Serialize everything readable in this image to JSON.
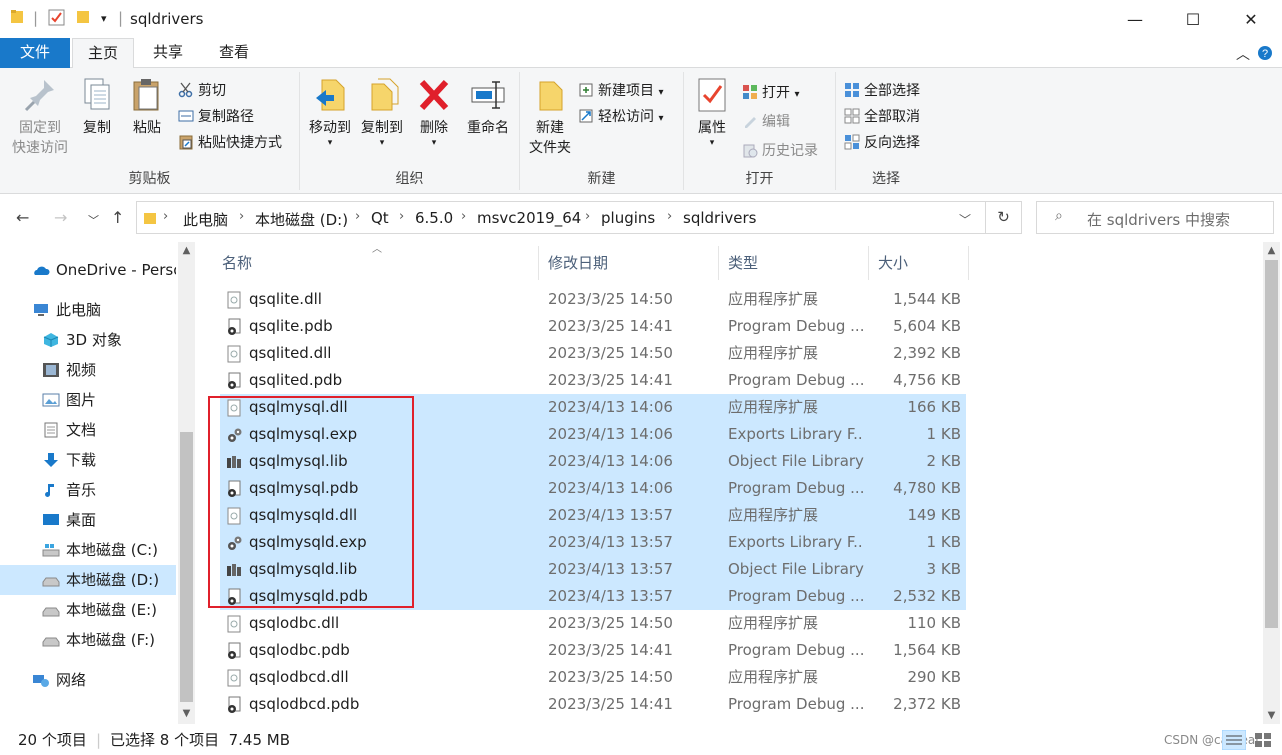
{
  "window": {
    "title": "sqldrivers",
    "minimize": "—",
    "maximize": "☐",
    "close": "✕"
  },
  "ribbon_tabs": [
    "文件",
    "主页",
    "共享",
    "查看"
  ],
  "ribbon": {
    "clipboard": {
      "label": "剪贴板",
      "pin": "固定到",
      "pin2": "快速访问",
      "copy": "复制",
      "paste": "粘贴",
      "cut": "剪切",
      "copy_path": "复制路径",
      "paste_shortcut": "粘贴快捷方式"
    },
    "organize": {
      "label": "组织",
      "move_to": "移动到",
      "copy_to": "复制到",
      "delete": "删除",
      "rename": "重命名"
    },
    "new": {
      "label": "新建",
      "new_folder": "新建",
      "new_folder2": "文件夹",
      "new_item": "新建项目",
      "easy_access": "轻松访问"
    },
    "open": {
      "label": "打开",
      "properties": "属性",
      "open": "打开",
      "edit": "编辑",
      "history": "历史记录"
    },
    "select": {
      "label": "选择",
      "select_all": "全部选择",
      "select_none": "全部取消",
      "invert": "反向选择"
    }
  },
  "address": {
    "crumbs": [
      "此电脑",
      "本地磁盘 (D:)",
      "Qt",
      "6.5.0",
      "msvc2019_64",
      "plugins",
      "sqldrivers"
    ],
    "search_placeholder": "在 sqldrivers 中搜索"
  },
  "nav": [
    {
      "label": "OneDrive - Perso",
      "icon": "onedrive-icon"
    },
    {
      "label": "此电脑",
      "icon": "computer-icon"
    },
    {
      "label": "3D 对象",
      "icon": "3d-objects-icon"
    },
    {
      "label": "视频",
      "icon": "video-icon"
    },
    {
      "label": "图片",
      "icon": "pictures-icon"
    },
    {
      "label": "文档",
      "icon": "documents-icon"
    },
    {
      "label": "下载",
      "icon": "download-icon"
    },
    {
      "label": "音乐",
      "icon": "music-icon"
    },
    {
      "label": "桌面",
      "icon": "desktop-icon"
    },
    {
      "label": "本地磁盘 (C:)",
      "icon": "system-drive-icon"
    },
    {
      "label": "本地磁盘 (D:)",
      "icon": "drive-icon"
    },
    {
      "label": "本地磁盘 (E:)",
      "icon": "drive-icon"
    },
    {
      "label": "本地磁盘 (F:)",
      "icon": "drive-icon"
    },
    {
      "label": "网络",
      "icon": "network-icon"
    }
  ],
  "columns": {
    "name": "名称",
    "date": "修改日期",
    "type": "类型",
    "size": "大小"
  },
  "files": [
    {
      "name": "qsqlite.dll",
      "date": "2023/3/25 14:50",
      "type": "应用程序扩展",
      "size": "1,544 KB",
      "icon": "dll-file-icon",
      "selected": false
    },
    {
      "name": "qsqlite.pdb",
      "date": "2023/3/25 14:41",
      "type": "Program Debug ...",
      "size": "5,604 KB",
      "icon": "pdb-file-icon",
      "selected": false
    },
    {
      "name": "qsqlited.dll",
      "date": "2023/3/25 14:50",
      "type": "应用程序扩展",
      "size": "2,392 KB",
      "icon": "dll-file-icon",
      "selected": false
    },
    {
      "name": "qsqlited.pdb",
      "date": "2023/3/25 14:41",
      "type": "Program Debug ...",
      "size": "4,756 KB",
      "icon": "pdb-file-icon",
      "selected": false
    },
    {
      "name": "qsqlmysql.dll",
      "date": "2023/4/13 14:06",
      "type": "应用程序扩展",
      "size": "166 KB",
      "icon": "dll-file-icon",
      "selected": true
    },
    {
      "name": "qsqlmysql.exp",
      "date": "2023/4/13 14:06",
      "type": "Exports Library F...",
      "size": "1 KB",
      "icon": "exp-file-icon",
      "selected": true
    },
    {
      "name": "qsqlmysql.lib",
      "date": "2023/4/13 14:06",
      "type": "Object File Library",
      "size": "2 KB",
      "icon": "lib-file-icon",
      "selected": true
    },
    {
      "name": "qsqlmysql.pdb",
      "date": "2023/4/13 14:06",
      "type": "Program Debug ...",
      "size": "4,780 KB",
      "icon": "pdb-file-icon",
      "selected": true
    },
    {
      "name": "qsqlmysqld.dll",
      "date": "2023/4/13 13:57",
      "type": "应用程序扩展",
      "size": "149 KB",
      "icon": "dll-file-icon",
      "selected": true
    },
    {
      "name": "qsqlmysqld.exp",
      "date": "2023/4/13 13:57",
      "type": "Exports Library F...",
      "size": "1 KB",
      "icon": "exp-file-icon",
      "selected": true
    },
    {
      "name": "qsqlmysqld.lib",
      "date": "2023/4/13 13:57",
      "type": "Object File Library",
      "size": "3 KB",
      "icon": "lib-file-icon",
      "selected": true
    },
    {
      "name": "qsqlmysqld.pdb",
      "date": "2023/4/13 13:57",
      "type": "Program Debug ...",
      "size": "2,532 KB",
      "icon": "pdb-file-icon",
      "selected": true
    },
    {
      "name": "qsqlodbc.dll",
      "date": "2023/3/25 14:50",
      "type": "应用程序扩展",
      "size": "110 KB",
      "icon": "dll-file-icon",
      "selected": false
    },
    {
      "name": "qsqlodbc.pdb",
      "date": "2023/3/25 14:41",
      "type": "Program Debug ...",
      "size": "1,564 KB",
      "icon": "pdb-file-icon",
      "selected": false
    },
    {
      "name": "qsqlodbcd.dll",
      "date": "2023/3/25 14:50",
      "type": "应用程序扩展",
      "size": "290 KB",
      "icon": "dll-file-icon",
      "selected": false
    },
    {
      "name": "qsqlodbcd.pdb",
      "date": "2023/3/25 14:41",
      "type": "Program Debug ...",
      "size": "2,372 KB",
      "icon": "pdb-file-icon",
      "selected": false
    }
  ],
  "status": {
    "count": "20 个项目",
    "selection": "已选择 8 个项目  7.45 MB",
    "watermark": "CSDN @casseal"
  }
}
